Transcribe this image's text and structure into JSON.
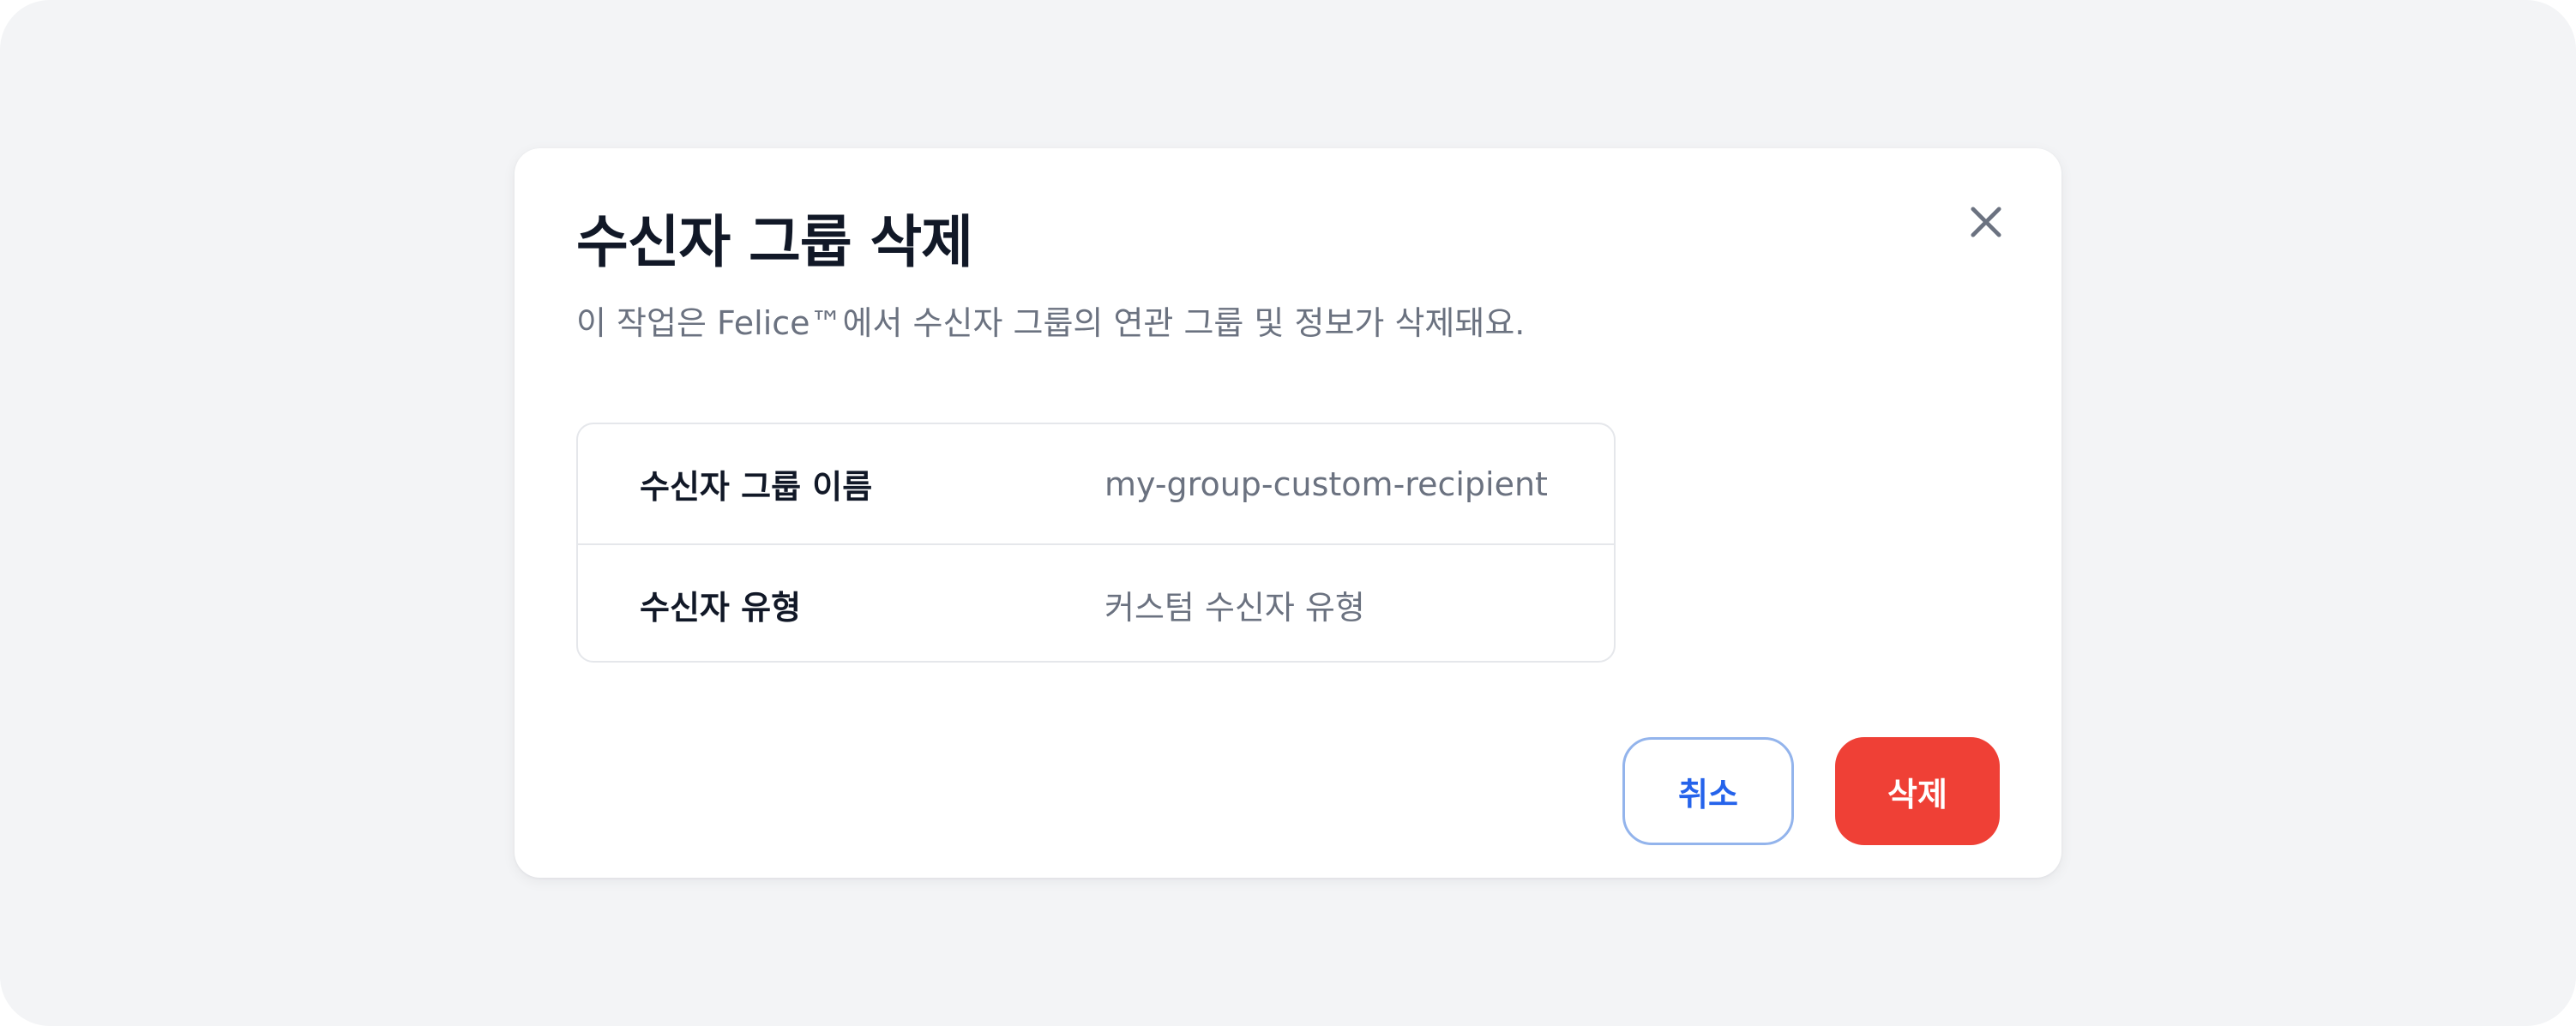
{
  "dialog": {
    "title": "수신자 그룹 삭제",
    "description": "이 작업은 Felice™에서 수신자 그룹의 연관 그룹 및 정보가 삭제돼요.",
    "close_icon": "close-icon",
    "info_rows": [
      {
        "label": "수신자 그룹 이름",
        "value": "my-group-custom-recipient"
      },
      {
        "label": "수신자 유형",
        "value": "커스텀 수신자 유형"
      }
    ],
    "cancel_label": "취소",
    "delete_label": "삭제"
  },
  "colors": {
    "backdrop": "#f3f4f6",
    "title": "#111827",
    "muted": "#6b7280",
    "cancel_border": "#93b4ec",
    "cancel_text": "#2563eb",
    "danger": "#ef4036"
  }
}
